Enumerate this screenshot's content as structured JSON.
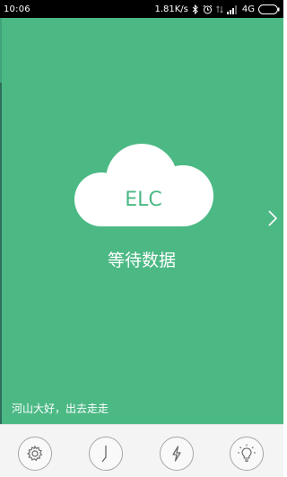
{
  "status_bar": {
    "time": "10:06",
    "network_speed": "1.81K/s",
    "network_type": "4G",
    "icons": [
      "bluetooth-icon",
      "alarm-icon",
      "data-transfer-icon",
      "signal-icon",
      "battery-icon"
    ]
  },
  "main": {
    "cloud_label": "ELC",
    "status_text": "等待数据",
    "motto": "河山大好，出去走走",
    "background_color": "#4cb985",
    "next_icon": "chevron-right-icon"
  },
  "toolbar": {
    "buttons": [
      {
        "name": "settings",
        "icon": "gear-icon"
      },
      {
        "name": "clock",
        "icon": "clock-icon"
      },
      {
        "name": "power",
        "icon": "lightning-icon"
      },
      {
        "name": "light",
        "icon": "lightbulb-icon"
      }
    ]
  }
}
